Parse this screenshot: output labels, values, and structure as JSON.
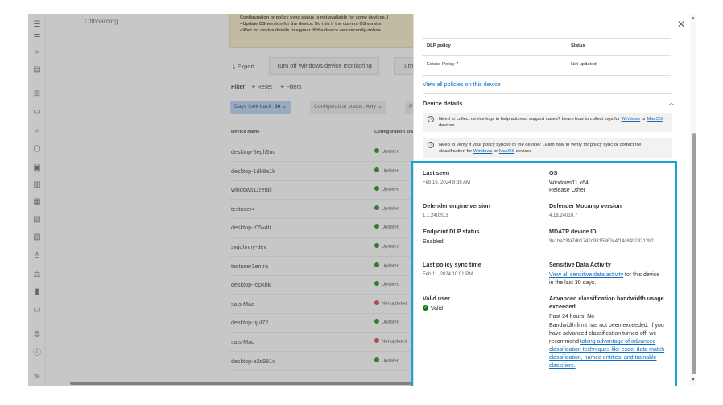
{
  "nav": {
    "offboarding": "Offboarding"
  },
  "rail_icons": [
    "hamburger-icon",
    "settings-sliders-icon",
    "search-icon",
    "reports-icon",
    "grid-icon",
    "document-icon",
    "search-doc-icon",
    "chat-icon",
    "document-check-icon",
    "building-icon",
    "archive-icon",
    "document-lock-icon",
    "document-shield-icon",
    "person-lock-icon",
    "scale-icon",
    "trash-icon",
    "device-icon",
    "gear-icon",
    "info-icon",
    "pencil-icon"
  ],
  "banner": {
    "title": "Configuration or policy sync status is not available for some devices. I",
    "line1": "Update OS version for the device. Do this if the current OS version",
    "line2": "Wait for device details to appear. If the device was recently onboa"
  },
  "toolbar": {
    "export": "Export",
    "turn_off_windows": "Turn off Windows device monitoring",
    "turn_off": "Turn off"
  },
  "filters": {
    "filter": "Filter",
    "reset": "Reset",
    "filters": "Filters"
  },
  "chips": {
    "days_label": "Days look back:",
    "days_value": "30",
    "config_label": "Configuration status:",
    "config_value": "Any",
    "policy": "Policy"
  },
  "table": {
    "headers": {
      "device_name": "Device name",
      "config_status": "Configuration status"
    },
    "rows": [
      {
        "name": "desktop-5egh5nd",
        "status": "Updated",
        "ok": true
      },
      {
        "name": "desktop-1dk8a1k",
        "status": "Updated",
        "ok": true
      },
      {
        "name": "windows11retail",
        "status": "Updated",
        "ok": true
      },
      {
        "name": "testuser4",
        "status": "Updated",
        "ok": true
      },
      {
        "name": "desktop-r05v4ti",
        "status": "Updated",
        "ok": true
      },
      {
        "name": "swjohnny-dev",
        "status": "Updated",
        "ok": true
      },
      {
        "name": "testuser3entra",
        "status": "Updated",
        "ok": true
      },
      {
        "name": "desktop-rdpkrik",
        "status": "Updated",
        "ok": true
      },
      {
        "name": "sais-Mac",
        "status": "Not updated",
        "ok": false
      },
      {
        "name": "desktop-tijul72",
        "status": "Updated",
        "ok": true
      },
      {
        "name": "sais-Mac",
        "status": "Not updated",
        "ok": false
      },
      {
        "name": "desktop-e2s981o",
        "status": "Updated",
        "ok": true
      }
    ]
  },
  "panel": {
    "policy_table": {
      "h_policy": "DLP policy",
      "h_status": "Status",
      "policy": "Edisco Policy 7",
      "status": "Not updated"
    },
    "view_all": "View all policies on this device",
    "section_title": "Device details",
    "info1": {
      "text1": "Need to collect device logs to help address support cases? Learn how to collect logs for",
      "link1": "Windows",
      "mid": "or",
      "link2": "MacOS",
      "end": "devices"
    },
    "info2": {
      "text1": "Need to verify if your policy synced to the device? Learn how to verify for policy sync or correct file classification for",
      "link1": "Windows",
      "mid": "or",
      "link2": "MacOS",
      "end": "devices"
    },
    "details": {
      "last_seen_label": "Last seen",
      "last_seen": "Feb 16, 2024 8:38 AM",
      "os_label": "OS",
      "os1": "Windows11 x64",
      "os2": "Release Other",
      "engine_label": "Defender engine version",
      "engine": "1.1.24020.3",
      "mocamp_label": "Defender Mocamp version",
      "mocamp": "4.18.24010.7",
      "dlp_label": "Endpoint DLP status",
      "dlp": "Enabled",
      "mdatp_label": "MDATP device ID",
      "mdatp": "9e1ba23fa7db1742d9815862e4f14c84929212b2",
      "sync_label": "Last policy sync time",
      "sync": "Feb 11, 2024 10:01 PM",
      "sda_label": "Sensitive Data Activity",
      "sda_link": "View all sensitive data activity",
      "sda_rest": "for this device in the last 30 days.",
      "valid_label": "Valid user",
      "valid": "Valid",
      "acb_label": "Advanced classification bandwidth usage exceeded",
      "acb_past": "Past 24 hours: No",
      "acb_text": "Bandwidth limit has not been exceeded. If you have advanced classification turned off, we recommend",
      "acb_link": "taking advantage of advanced classification techniques like exact data match classification, named entities, and trainable classifiers."
    }
  }
}
